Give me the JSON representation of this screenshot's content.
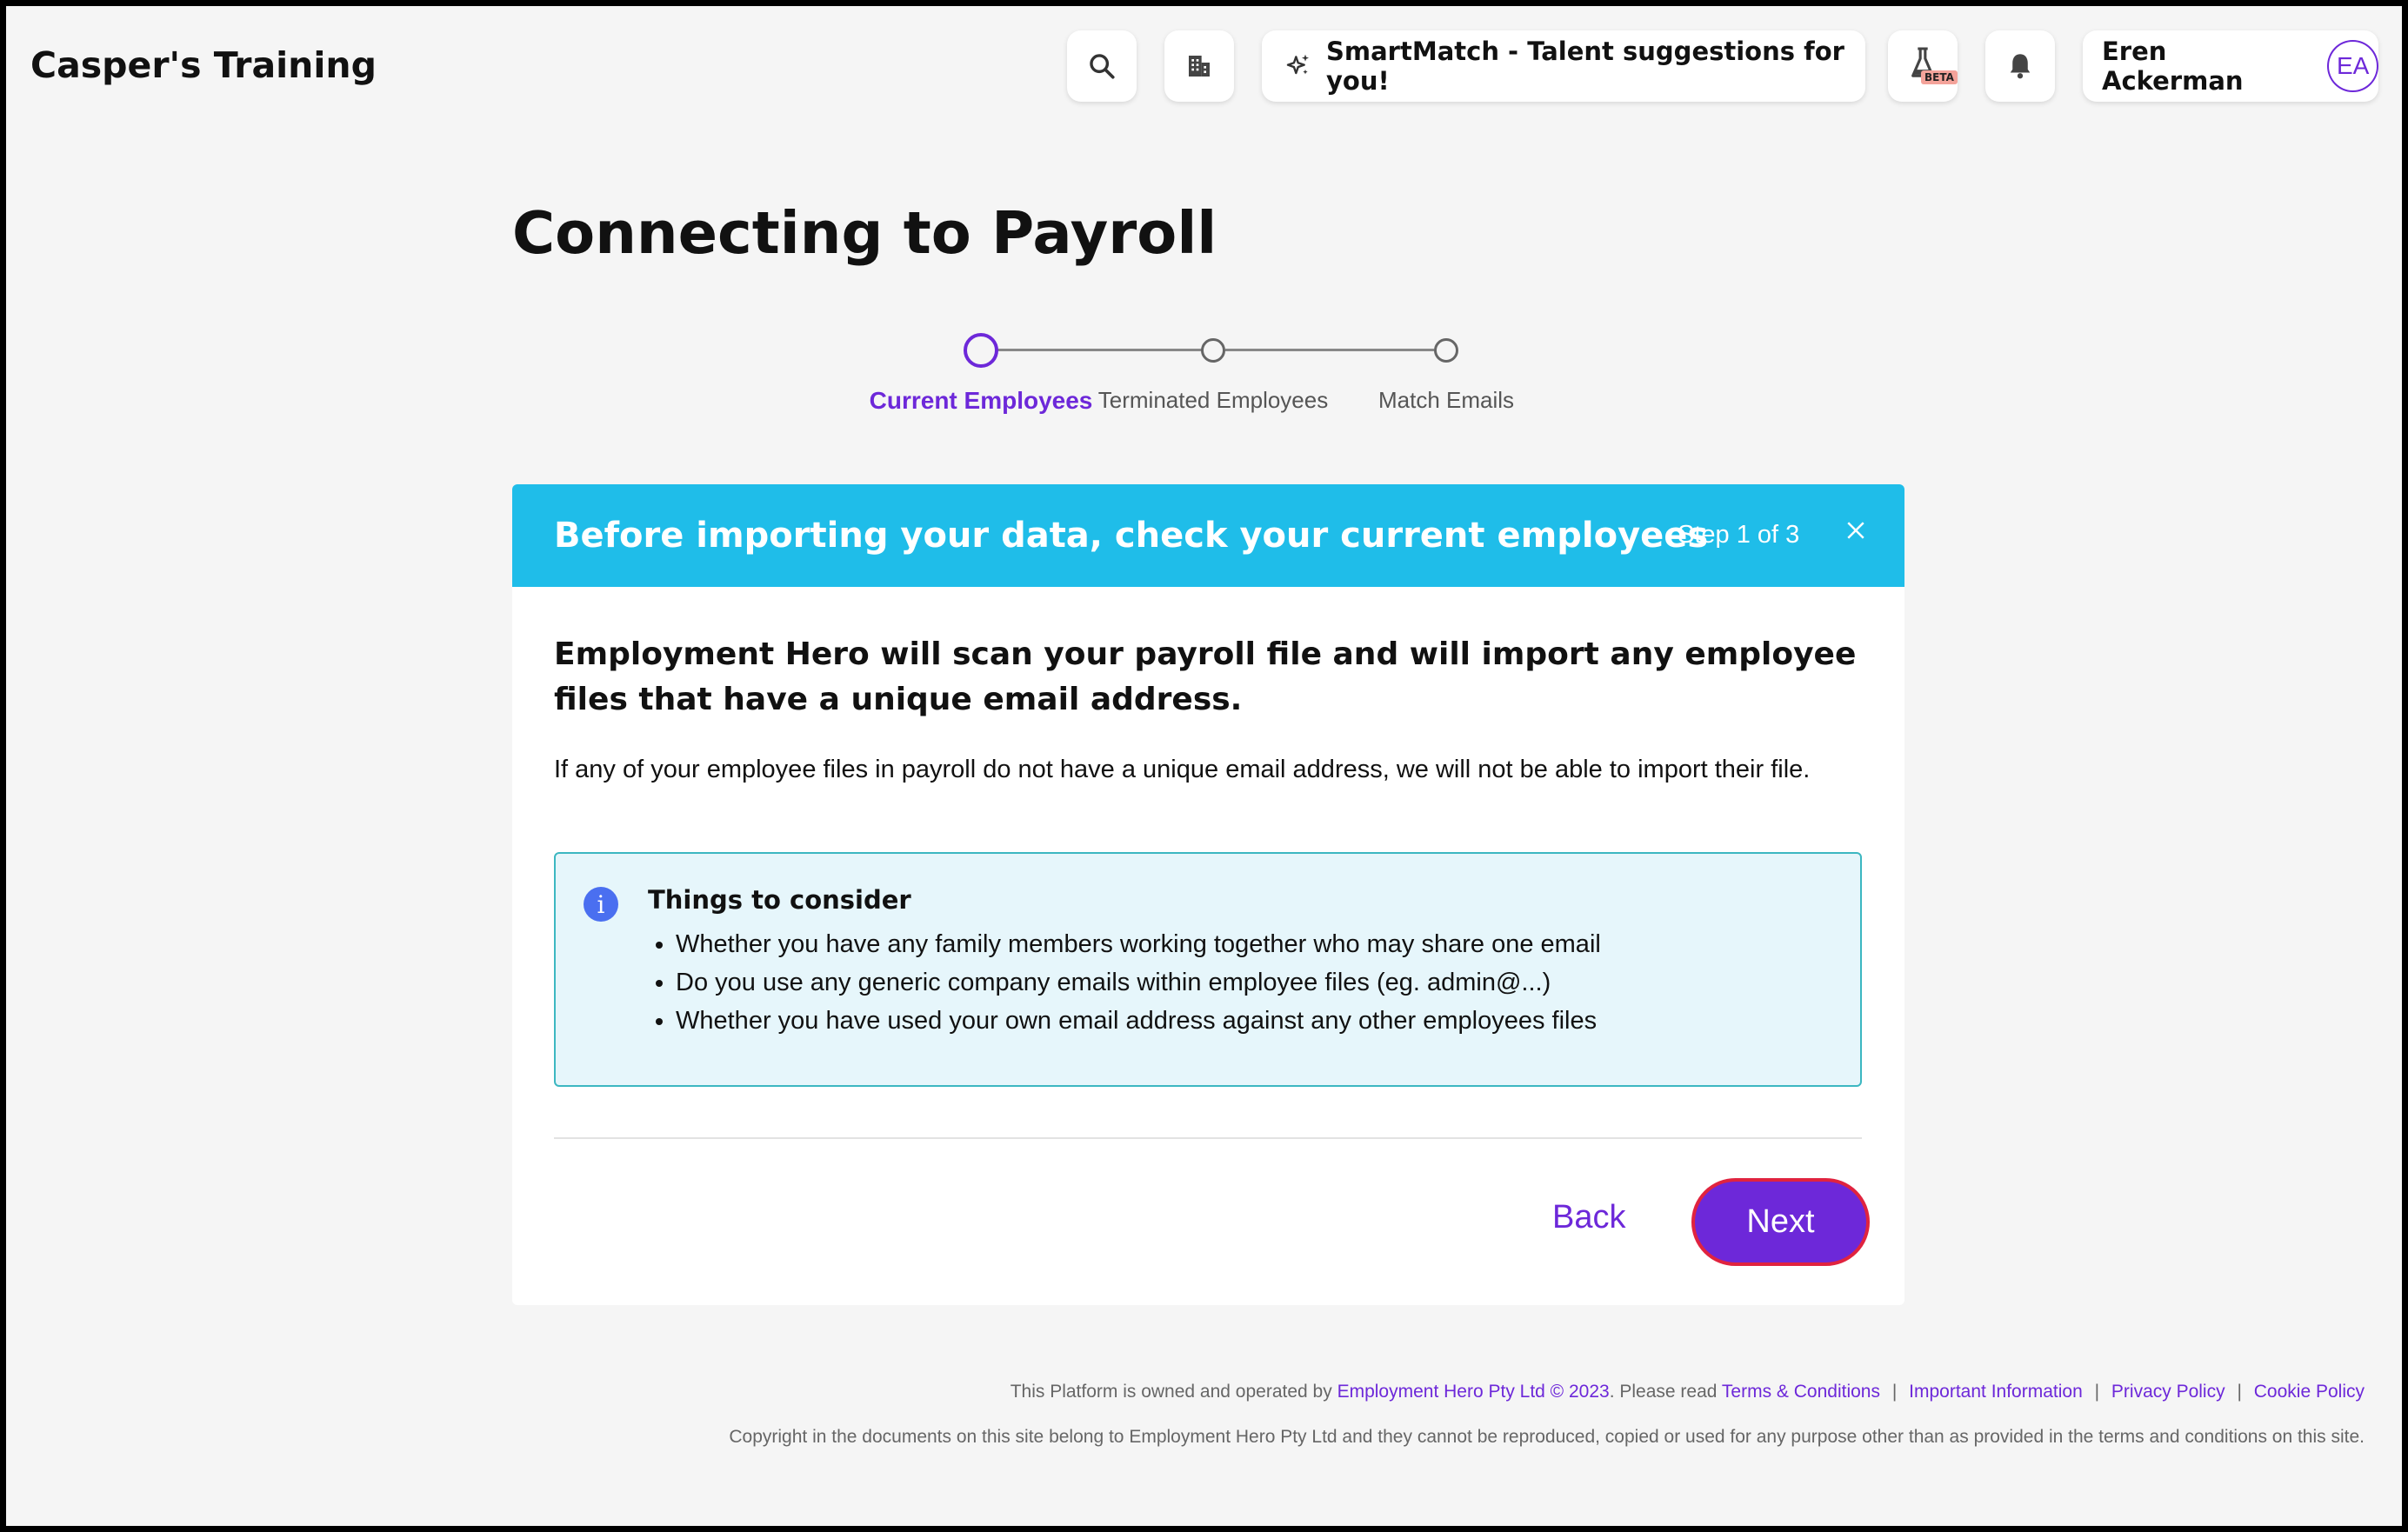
{
  "header": {
    "app_title": "Casper's Training",
    "smartmatch_label": "SmartMatch - Talent suggestions for you!",
    "beta_badge": "BETA",
    "user_name": "Eren Ackerman",
    "user_initials": "EA",
    "icons": [
      "search-icon",
      "building-icon",
      "sparkle-icon",
      "flask-icon",
      "bell-icon"
    ]
  },
  "page": {
    "title": "Connecting to Payroll"
  },
  "stepper": {
    "steps": [
      {
        "label": "Current Employees",
        "state": "active"
      },
      {
        "label": "Terminated Employees",
        "state": "pending"
      },
      {
        "label": "Match Emails",
        "state": "pending"
      }
    ]
  },
  "card": {
    "header_title": "Before importing your data, check your current employees",
    "step_indicator": "Step 1 of 3",
    "lead": "Employment Hero will scan your payroll file and will import any employee files that have a unique email address.",
    "body": "If any of your employee files in payroll do not have a unique email address, we will not be able to import their file.",
    "info": {
      "icon_glyph": "i",
      "title": "Things to consider",
      "items": [
        "Whether you have any family members working together who may share one email",
        "Do you use any generic company emails within employee files (eg. admin@...)",
        "Whether you have used your own email address against any other employees files"
      ]
    },
    "back_label": "Back",
    "next_label": "Next"
  },
  "footer": {
    "owned_prefix": "This Platform is owned and operated by",
    "owner_link": "Employment Hero Pty Ltd © 2023",
    "read_text": ". Please read",
    "links": [
      "Terms & Conditions",
      "Important Information",
      "Privacy Policy",
      "Cookie Policy"
    ],
    "separator": "|",
    "copyright": "Copyright in the documents on this site belong to Employment Hero Pty Ltd and they cannot be reproduced, copied or used for any purpose other than as provided in the terms and conditions on this site."
  },
  "colors": {
    "accent": "#6d28d9",
    "card_header": "#1fbde9",
    "info_bg": "#e6f6fb",
    "info_border": "#3cb7c1",
    "next_border": "#e0233f"
  }
}
